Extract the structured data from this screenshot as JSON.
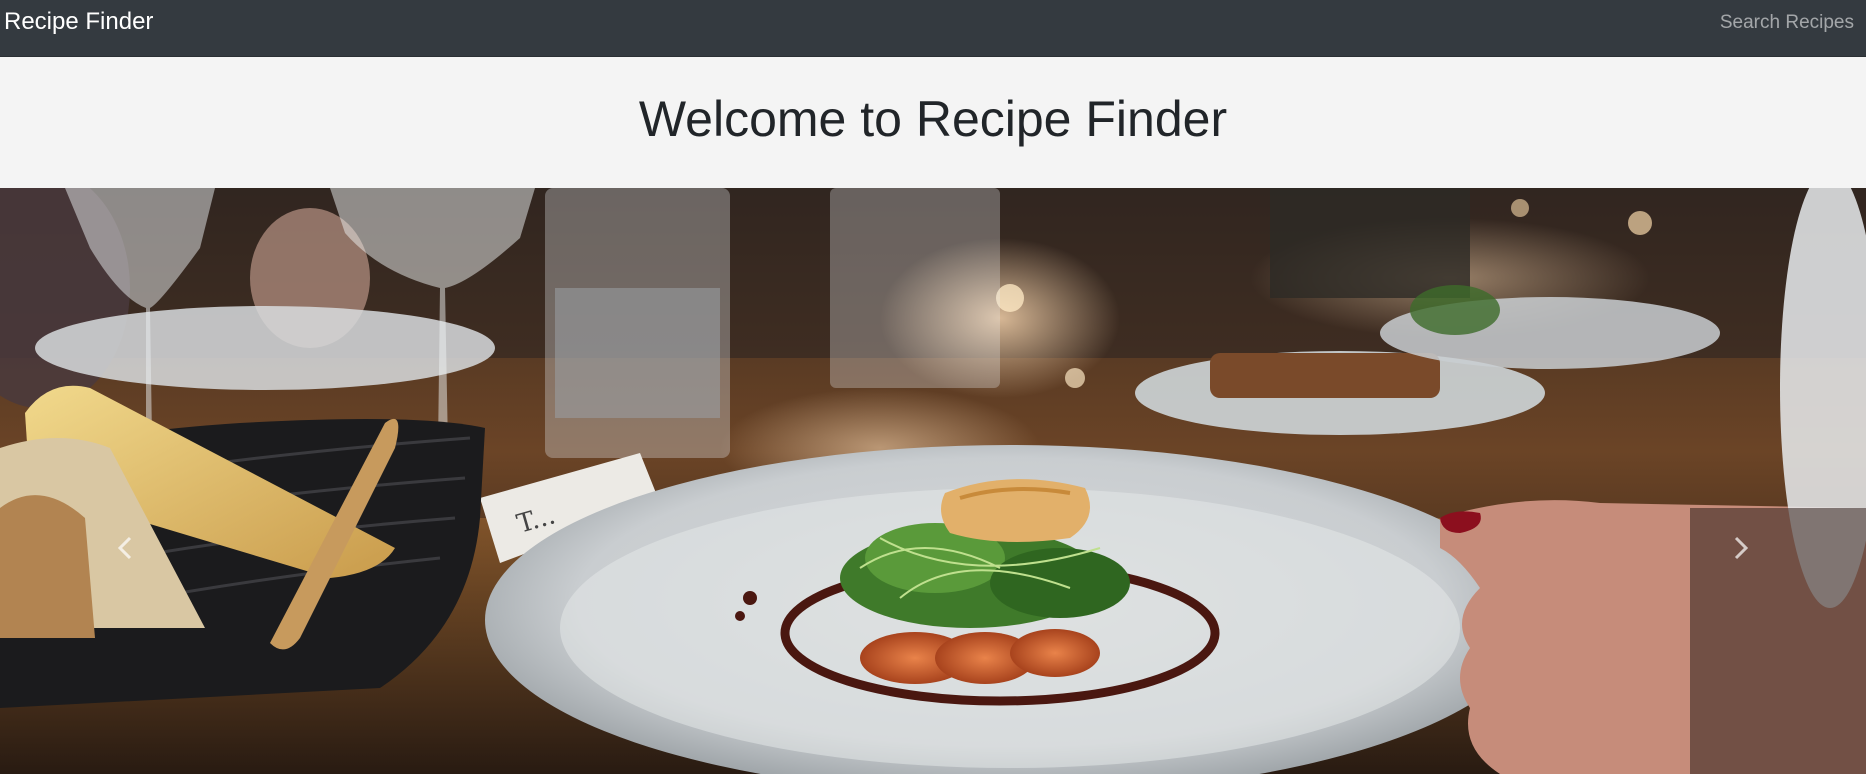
{
  "navbar": {
    "brand": "Recipe Finder",
    "search_link": "Search Recipes"
  },
  "hero": {
    "title": "Welcome to Recipe Finder"
  },
  "carousel": {
    "prev_icon": "chevron-left-icon",
    "next_icon": "chevron-right-icon"
  },
  "colors": {
    "navbar_bg": "#343a40",
    "hero_bg": "#f4f4f4",
    "title_text": "#212529"
  }
}
